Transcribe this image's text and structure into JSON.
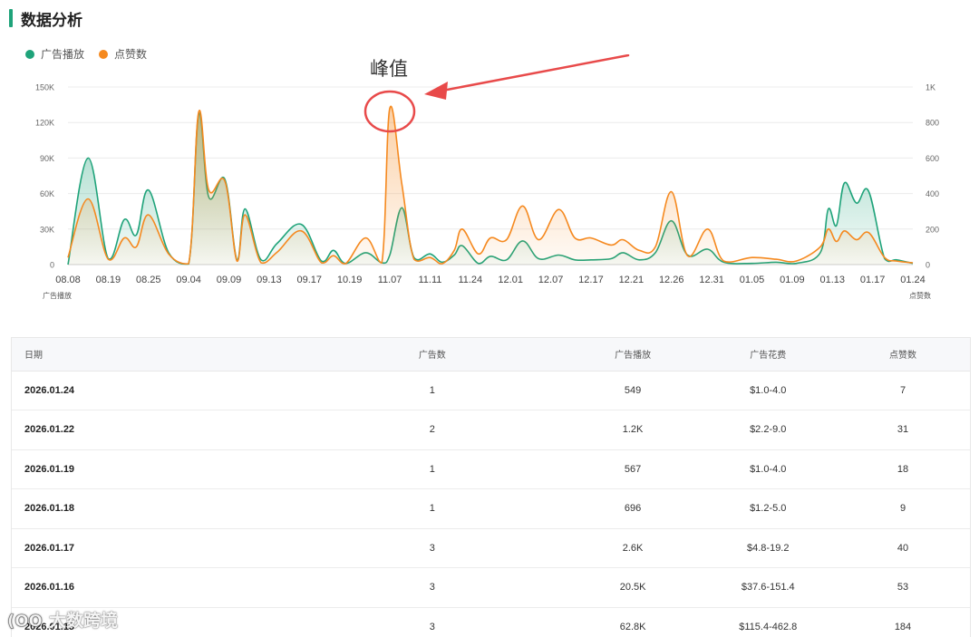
{
  "section": {
    "title": "数据分析"
  },
  "legend": [
    {
      "label": "广告播放",
      "color": "#1fa37a"
    },
    {
      "label": "点赞数",
      "color": "#f5891f"
    }
  ],
  "annotation": {
    "text": "峰值",
    "color": "#e84a4a"
  },
  "chart_data": {
    "type": "area",
    "x": [
      "08.08",
      "08.19",
      "08.25",
      "09.04",
      "09.09",
      "09.13",
      "09.17",
      "10.19",
      "11.07",
      "11.11",
      "11.24",
      "12.01",
      "12.07",
      "12.17",
      "12.21",
      "12.26",
      "12.31",
      "01.05",
      "01.09",
      "01.13",
      "01.17",
      "01.24"
    ],
    "left_axis": {
      "label": "广告播放",
      "ticks": [
        "0",
        "30K",
        "60K",
        "90K",
        "120K",
        "150K"
      ],
      "range": [
        0,
        150000
      ]
    },
    "right_axis": {
      "label": "点赞数",
      "ticks": [
        "0",
        "200",
        "400",
        "600",
        "800",
        "1K"
      ],
      "range": [
        0,
        1000
      ]
    },
    "grid": true,
    "legend_position": "top-left",
    "series": [
      {
        "name": "广告播放",
        "axis": "left",
        "color": "#1fa37a",
        "points": [
          [
            0,
            0
          ],
          [
            0.5,
            90000
          ],
          [
            1,
            5000
          ],
          [
            1.4,
            38000
          ],
          [
            1.7,
            25000
          ],
          [
            2,
            63000
          ],
          [
            2.5,
            10000
          ],
          [
            3,
            500
          ],
          [
            3.25,
            127000
          ],
          [
            3.5,
            57000
          ],
          [
            3.9,
            72000
          ],
          [
            4.2,
            4000
          ],
          [
            4.4,
            47000
          ],
          [
            4.8,
            4000
          ],
          [
            5.2,
            18000
          ],
          [
            5.8,
            34000
          ],
          [
            6.3,
            3000
          ],
          [
            6.6,
            12000
          ],
          [
            6.9,
            1000
          ],
          [
            7.4,
            10000
          ],
          [
            7.8,
            1500
          ],
          [
            8,
            8000
          ],
          [
            8.3,
            48000
          ],
          [
            8.6,
            6000
          ],
          [
            9,
            9000
          ],
          [
            9.3,
            2000
          ],
          [
            9.6,
            8000
          ],
          [
            9.8,
            16000
          ],
          [
            10.2,
            1000
          ],
          [
            10.5,
            7000
          ],
          [
            10.9,
            4000
          ],
          [
            11.3,
            20000
          ],
          [
            11.7,
            5000
          ],
          [
            12.2,
            8000
          ],
          [
            12.6,
            4000
          ],
          [
            13,
            4000
          ],
          [
            13.5,
            5000
          ],
          [
            13.8,
            10000
          ],
          [
            14.2,
            4000
          ],
          [
            14.6,
            10000
          ],
          [
            15,
            37000
          ],
          [
            15.4,
            8000
          ],
          [
            15.9,
            13000
          ],
          [
            16.3,
            2000
          ],
          [
            17,
            1000
          ],
          [
            17.6,
            2000
          ],
          [
            18.1,
            1000
          ],
          [
            18.7,
            10000
          ],
          [
            18.9,
            47000
          ],
          [
            19.1,
            33000
          ],
          [
            19.3,
            69000
          ],
          [
            19.6,
            52000
          ],
          [
            19.9,
            62000
          ],
          [
            20.3,
            5000
          ],
          [
            20.6,
            4000
          ],
          [
            21,
            1000
          ]
        ]
      },
      {
        "name": "点赞数",
        "axis": "right",
        "color": "#f5891f",
        "points": [
          [
            0,
            40
          ],
          [
            0.5,
            370
          ],
          [
            1,
            30
          ],
          [
            1.4,
            150
          ],
          [
            1.7,
            100
          ],
          [
            2,
            280
          ],
          [
            2.5,
            60
          ],
          [
            3,
            5
          ],
          [
            3.25,
            860
          ],
          [
            3.5,
            420
          ],
          [
            3.9,
            470
          ],
          [
            4.2,
            20
          ],
          [
            4.4,
            280
          ],
          [
            4.8,
            10
          ],
          [
            5.2,
            70
          ],
          [
            5.8,
            190
          ],
          [
            6.3,
            10
          ],
          [
            6.6,
            50
          ],
          [
            6.9,
            5
          ],
          [
            7.4,
            150
          ],
          [
            7.8,
            10
          ],
          [
            8,
            880
          ],
          [
            8.3,
            450
          ],
          [
            8.6,
            30
          ],
          [
            9,
            40
          ],
          [
            9.3,
            5
          ],
          [
            9.6,
            80
          ],
          [
            9.8,
            200
          ],
          [
            10.2,
            60
          ],
          [
            10.5,
            150
          ],
          [
            10.9,
            140
          ],
          [
            11.3,
            330
          ],
          [
            11.7,
            140
          ],
          [
            12.2,
            310
          ],
          [
            12.6,
            150
          ],
          [
            13,
            150
          ],
          [
            13.5,
            110
          ],
          [
            13.8,
            140
          ],
          [
            14.2,
            80
          ],
          [
            14.6,
            100
          ],
          [
            15,
            410
          ],
          [
            15.4,
            50
          ],
          [
            15.9,
            200
          ],
          [
            16.3,
            20
          ],
          [
            17,
            40
          ],
          [
            17.6,
            30
          ],
          [
            18.1,
            20
          ],
          [
            18.7,
            100
          ],
          [
            18.9,
            200
          ],
          [
            19.1,
            130
          ],
          [
            19.3,
            190
          ],
          [
            19.6,
            140
          ],
          [
            19.9,
            180
          ],
          [
            20.3,
            40
          ],
          [
            20.6,
            20
          ],
          [
            21,
            10
          ]
        ]
      }
    ]
  },
  "table": {
    "headers": [
      "日期",
      "广告数",
      "广告播放",
      "广告花费",
      "点赞数"
    ],
    "rows": [
      [
        "2026.01.24",
        "1",
        "549",
        "$1.0-4.0",
        "7"
      ],
      [
        "2026.01.22",
        "2",
        "1.2K",
        "$2.2-9.0",
        "31"
      ],
      [
        "2026.01.19",
        "1",
        "567",
        "$1.0-4.0",
        "18"
      ],
      [
        "2026.01.18",
        "1",
        "696",
        "$1.2-5.0",
        "9"
      ],
      [
        "2026.01.17",
        "3",
        "2.6K",
        "$4.8-19.2",
        "40"
      ],
      [
        "2026.01.16",
        "3",
        "20.5K",
        "$37.6-151.4",
        "53"
      ],
      [
        "2026.01.15",
        "3",
        "62.8K",
        "$115.4-462.8",
        "184"
      ]
    ]
  },
  "watermark": {
    "text": "大数跨境"
  }
}
